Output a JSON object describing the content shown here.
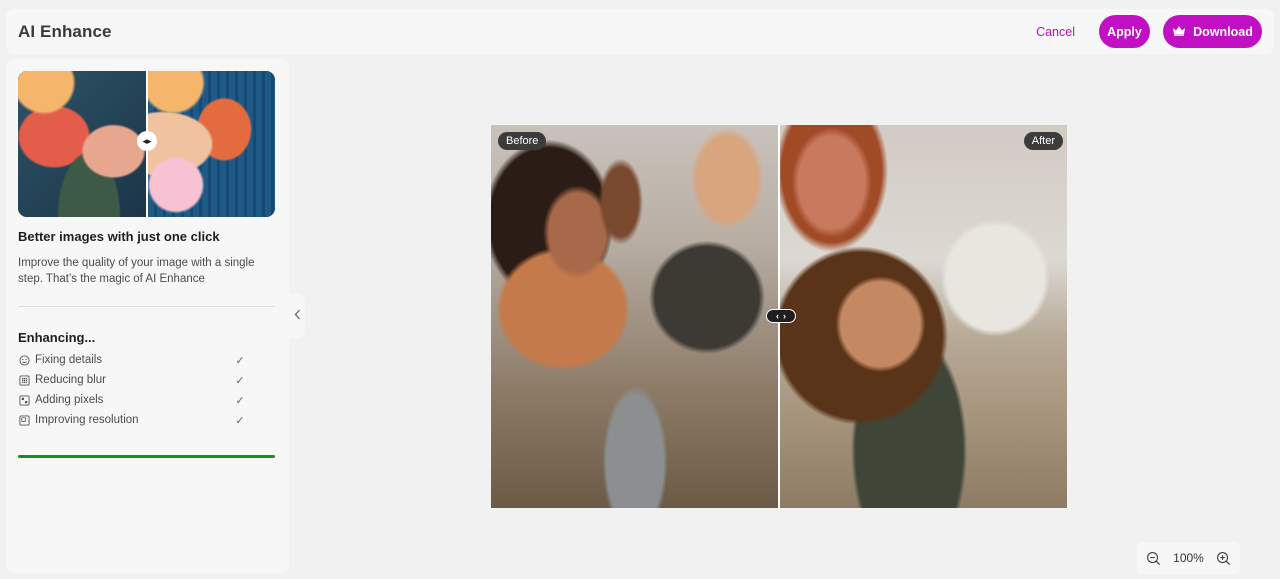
{
  "header": {
    "title": "AI Enhance",
    "cancel_label": "Cancel",
    "apply_label": "Apply",
    "download_label": "Download",
    "download_icon": "crown-icon"
  },
  "sidebar": {
    "heading": "Better images with just one click",
    "description": "Improve the quality of your image with a single step. That’s the magic of AI Enhance",
    "enhancing_title": "Enhancing...",
    "steps": [
      {
        "label": "Fixing details",
        "icon": "smiley-icon",
        "done": true
      },
      {
        "label": "Reducing blur",
        "icon": "blur-grid-icon",
        "done": true
      },
      {
        "label": "Adding pixels",
        "icon": "pixels-icon",
        "done": true
      },
      {
        "label": "Improving resolution",
        "icon": "resolution-icon",
        "done": true
      }
    ],
    "progress": 1.0
  },
  "canvas": {
    "before_label": "Before",
    "after_label": "After"
  },
  "zoom": {
    "value": "100%"
  },
  "colors": {
    "accent": "#c10fc4",
    "progress": "#1e8a2a"
  }
}
